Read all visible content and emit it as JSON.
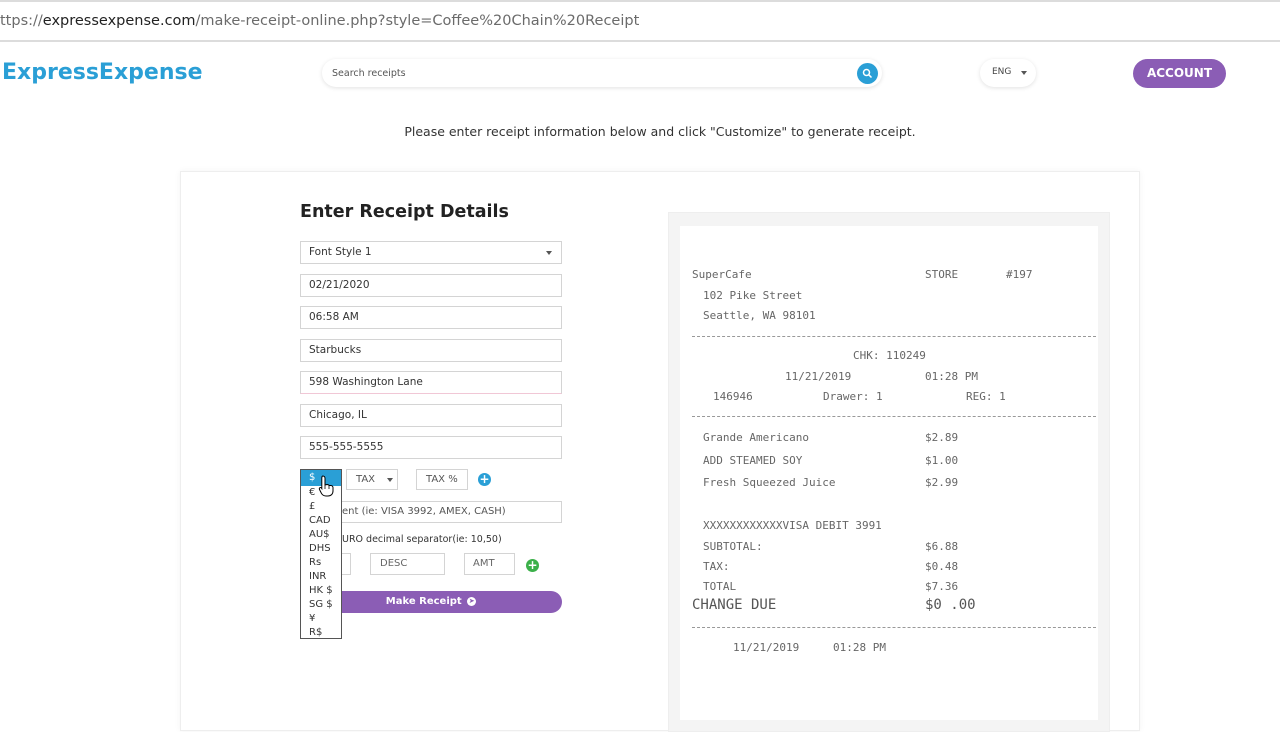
{
  "browser": {
    "url_prefix": "ttps://",
    "url_host": "expressexpense.com",
    "url_path": "/make-receipt-online.php?style=Coffee%20Chain%20Receipt"
  },
  "header": {
    "logo": "ExpressExpense",
    "search_placeholder": "Search receipts",
    "language": "ENG",
    "account_label": "ACCOUNT"
  },
  "instruction": "Please enter receipt information below and click \"Customize\" to generate receipt.",
  "form": {
    "title": "Enter Receipt Details",
    "font_style": "Font Style 1",
    "date": "02/21/2020",
    "time": "06:58 AM",
    "business_name": "Starbucks",
    "address": "598 Washington Lane",
    "city": "Chicago, IL",
    "phone": "555-555-5555",
    "currency_selected": "$",
    "tax_label": "TAX",
    "tax_percent_label": "TAX %",
    "payment_placeholder": "ent (ie: VISA 3992, AMEX, CASH)",
    "euro_label": "URO decimal separator(ie: 10,50)",
    "desc_label": "DESC",
    "amt_label": "AMT",
    "make_receipt_label": "Make Receipt",
    "currency_options": [
      "$",
      "€",
      "£",
      "CAD",
      "AU$",
      "DHS",
      "Rs",
      "INR",
      "HK $",
      "SG $",
      "¥",
      "R$"
    ]
  },
  "receipt": {
    "store_name": "SuperCafe",
    "store_label": "STORE",
    "store_number": "#197",
    "address_line1": "102 Pike Street",
    "address_line2": "Seattle, WA 98101",
    "chk": "CHK: 110249",
    "date": "11/21/2019",
    "time": "01:28 PM",
    "order_id": "146946",
    "drawer": "Drawer: 1",
    "reg": "REG: 1",
    "items": [
      {
        "name": "Grande Americano",
        "price": "$2.89"
      },
      {
        "name": "ADD STEAMED SOY",
        "price": "$1.00"
      },
      {
        "name": "Fresh Squeezed Juice",
        "price": "$2.99"
      }
    ],
    "payment": "XXXXXXXXXXXXVISA DEBIT 3991",
    "subtotal_label": "SUBTOTAL:",
    "subtotal": "$6.88",
    "tax_label": "TAX:",
    "tax": "$0.48",
    "total_label": "TOTAL",
    "total": "$7.36",
    "change_label": "CHANGE DUE",
    "change": "$0 .00",
    "footer_date": "11/21/2019",
    "footer_time": "01:28 PM"
  },
  "colors": {
    "brand_blue": "#2a9fd6",
    "brand_purple": "#8b5db5",
    "add_green": "#3cb04a"
  }
}
